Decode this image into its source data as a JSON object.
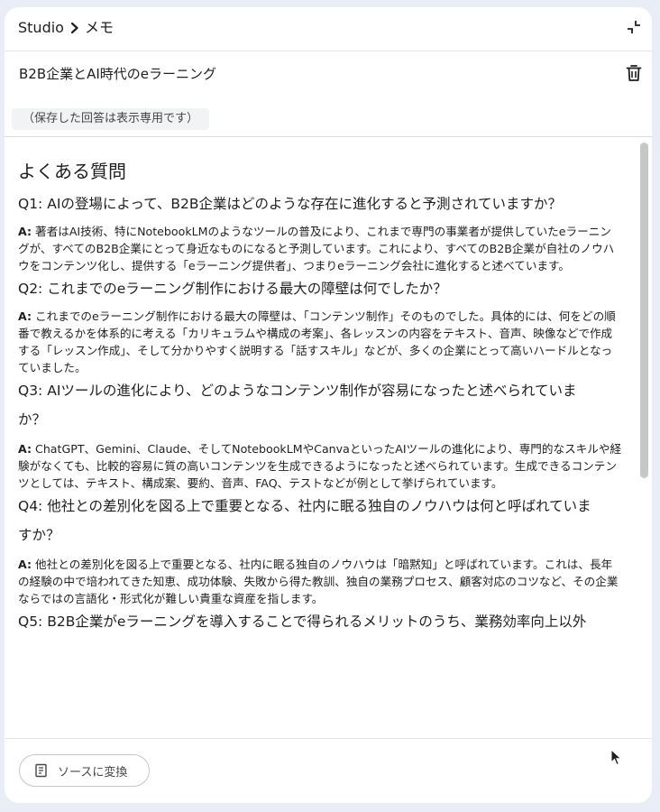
{
  "breadcrumb": {
    "root": "Studio",
    "current": "メモ"
  },
  "note": {
    "title": "B2B企業とAI時代のeラーニング",
    "readonly_label": "（保存した回答は表示専用です）"
  },
  "faq": {
    "heading": "よくある質問",
    "items": [
      {
        "q_line1": "Q1: AIの登場によって、B2B企業はどのような存在に進化すると予測されていますか？",
        "a_label": "A:",
        "a_text": " 著者はAI技術、特にNotebookLMのようなツールの普及により、これまで専門の事業者が提供していたeラーニングが、すべてのB2B企業にとって身近なものになると予測しています。これにより、すべてのB2B企業が自社のノウハウをコンテンツ化し、提供する「eラーニング提供者」、つまりeラーニング会社に進化すると述べています。"
      },
      {
        "q_line1": "Q2: これまでのeラーニング制作における最大の障壁は何でしたか？",
        "a_label": "A:",
        "a_text": " これまでのeラーニング制作における最大の障壁は、「コンテンツ制作」そのものでした。具体的には、何をどの順番で教えるかを体系的に考える「カリキュラムや構成の考案」、各レッスンの内容をテキスト、音声、映像などで作成する「レッスン作成」、そして分かりやすく説明する「話すスキル」などが、多くの企業にとって高いハードルとなっていました。"
      },
      {
        "q_line1": "Q3: AIツールの進化により、どのようなコンテンツ制作が容易になったと述べられていま",
        "q_line2": "か？",
        "a_label": "A:",
        "a_text": " ChatGPT、Gemini、Claude、そしてNotebookLMやCanvaといったAIツールの進化により、専門的なスキルや経験がなくても、比較的容易に質の高いコンテンツを生成できるようになったと述べられています。生成できるコンテンツとしては、テキスト、構成案、要約、音声、FAQ、テストなどが例として挙げられています。"
      },
      {
        "q_line1": "Q4: 他社との差別化を図る上で重要となる、社内に眠る独自のノウハウは何と呼ばれていま",
        "q_line2": "すか？",
        "a_label": "A:",
        "a_text": " 他社との差別化を図る上で重要となる、社内に眠る独自のノウハウは「暗黙知」と呼ばれています。これは、長年の経験の中で培われてきた知恵、成功体験、失敗から得た教訓、独自の業務プロセス、顧客対応のコツなど、その企業ならではの言語化・形式化が難しい貴重な資産を指します。"
      },
      {
        "q_line1": "Q5: B2B企業がeラーニングを導入することで得られるメリットのうち、業務効率向上以外"
      }
    ]
  },
  "footer": {
    "convert_label": "ソースに変換"
  },
  "icons": {
    "chevron": "chevron-right-icon",
    "collapse": "collapse-icon",
    "trash": "trash-icon",
    "convert": "note-convert-icon",
    "cursor": "mouse-pointer-icon"
  }
}
